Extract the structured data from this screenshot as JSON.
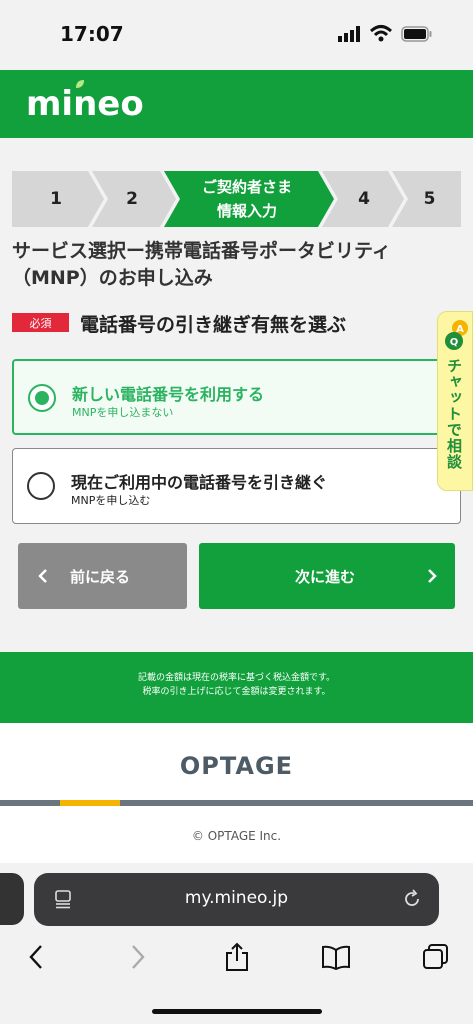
{
  "status_bar": {
    "time": "17:07"
  },
  "header": {
    "logo": "mineo"
  },
  "steps": {
    "step1": "1",
    "step2": "2",
    "current_line1": "ご契約者さま",
    "current_line2": "情報入力",
    "step4": "4",
    "step5": "5"
  },
  "page": {
    "title_line1": "サービス選択ー携帯電話番号ポータビリティ",
    "title_line2": "（MNP）のお申し込み",
    "required_badge": "必須",
    "section_title": "電話番号の引き継ぎ有無を選ぶ"
  },
  "options": [
    {
      "label": "新しい電話番号を利用する",
      "sub": "MNPを申し込まない",
      "selected": true
    },
    {
      "label": "現在ご利用中の電話番号を引き継ぐ",
      "sub": "MNPを申し込む",
      "selected": false
    }
  ],
  "buttons": {
    "back": "前に戻る",
    "next": "次に進む"
  },
  "chat": {
    "label": "チャットで相談"
  },
  "footer": {
    "note_line1": "記載の金額は現在の税率に基づく税込金額です。",
    "note_line2": "税率の引き上げに応じて金額は変更されます。",
    "brand": "OPTAGE",
    "copyright": "© OPTAGE Inc."
  },
  "browser": {
    "url": "my.mineo.jp"
  },
  "colors": {
    "brand_green": "#11a03c",
    "option_green": "#2bb460",
    "required_red": "#e3283b"
  }
}
